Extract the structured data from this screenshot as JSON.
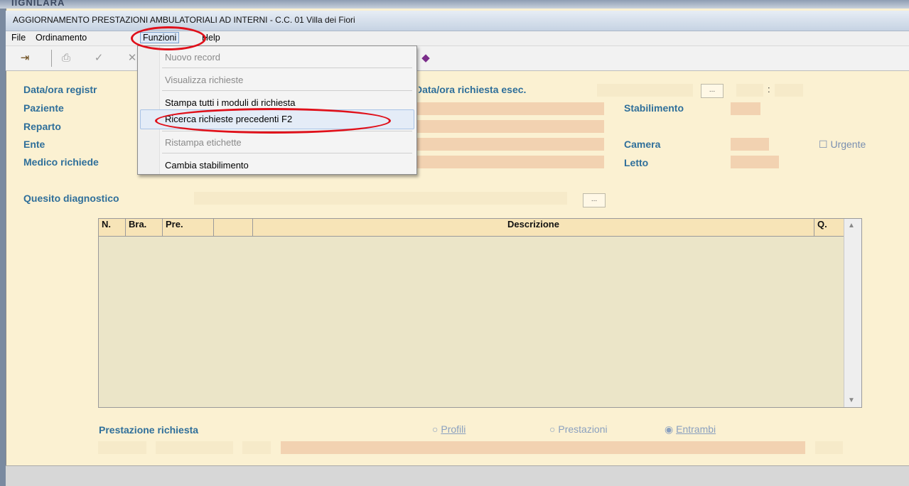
{
  "background_window_title": "IIGNILARA",
  "window": {
    "title": "AGGIORNAMENTO PRESTAZIONI AMBULATORIALI AD INTERNI - C.C.  01 Villa dei Fiori"
  },
  "menubar": {
    "file": "File",
    "ordinamento": "Ordinamento",
    "funzioni": "Funzioni",
    "help": "Help"
  },
  "toolbar": {
    "icons": [
      "exit-door-icon",
      "print-icon",
      "confirm-check-icon",
      "cancel-icon",
      "book-icon"
    ]
  },
  "dropdown": {
    "items": [
      {
        "label": "Nuovo record",
        "enabled": false
      },
      {
        "label": "Visualizza richieste",
        "enabled": false
      },
      {
        "label": "Stampa tutti i moduli di richiesta",
        "enabled": true
      },
      {
        "label": "Ricerca richieste precedenti F2",
        "enabled": true,
        "highlighted": true
      },
      {
        "label": "Ristampa etichette",
        "enabled": false
      },
      {
        "label": "Cambia stabilimento",
        "enabled": true
      }
    ]
  },
  "form": {
    "data_ora_registr": "Data/ora registr",
    "data_ora_richiesta": "Data/ora richiesta esec.",
    "time_sep": ":",
    "paziente": "Paziente",
    "stabilimento": "Stabilimento",
    "reparto": "Reparto",
    "ente": "Ente",
    "camera": "Camera",
    "urgente": "Urgente",
    "medico": "Medico richiede",
    "letto": "Letto",
    "quesito": "Quesito diagnostico",
    "dots": "..."
  },
  "grid": {
    "columns": [
      "N.",
      "Bra.",
      "Pre.",
      "",
      "Descrizione",
      "Q."
    ]
  },
  "prestazione": {
    "label": "Prestazione richiesta",
    "radios": [
      {
        "label": "Profili",
        "selected": false
      },
      {
        "label": "Prestazioni",
        "selected": false
      },
      {
        "label": "Entrambi",
        "selected": true
      }
    ]
  },
  "colors": {
    "accent_label": "#2f6f9a",
    "field": "#f2d2b1",
    "window_bg": "#fbf1d2",
    "annotation_ring": "#e0101a"
  }
}
